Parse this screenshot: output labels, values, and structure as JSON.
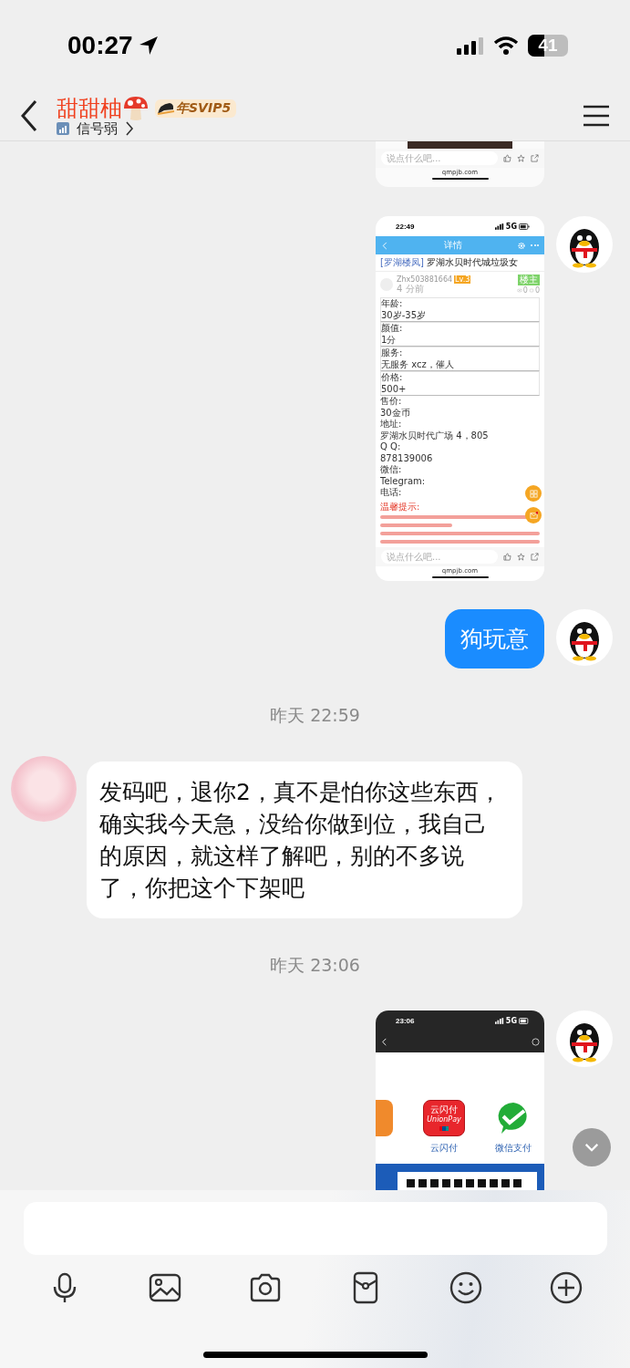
{
  "status_bar": {
    "time": "00:27",
    "battery": "41"
  },
  "header": {
    "name": "甜甜柚",
    "badge": "年SVIP5",
    "subtitle": "信号弱"
  },
  "messages": [
    {
      "kind": "image",
      "outgoing": true,
      "show_avatar": false,
      "screen": {
        "kind": "post_footer",
        "comment_placeholder": "说点什么吧...",
        "domain": "qmpjb.com"
      }
    },
    {
      "kind": "image",
      "outgoing": true,
      "show_avatar": true,
      "screen": {
        "kind": "post_detail",
        "time": "22:49",
        "network": "5G",
        "header_title": "详情",
        "tag": "[罗湖楼凤]",
        "title": "罗湖水贝时代城垃圾女",
        "user": "Zhx503881664",
        "level": "Lv.3",
        "posted": "4 分前",
        "role": "楼主",
        "views": "0",
        "comments": "0",
        "fields": [
          {
            "label": "年龄:",
            "value": "30岁-35岁",
            "boxed": true
          },
          {
            "label": "颜值:",
            "value": "1分",
            "boxed": true
          },
          {
            "label": "服务:",
            "value": "无服务 xcz，催人",
            "boxed": true
          },
          {
            "label": "价格:",
            "value": "500+",
            "boxed": true
          },
          {
            "label": "售价:",
            "value": "30金币",
            "boxed": false
          },
          {
            "label": "地址:",
            "value": "罗湖水贝时代广场 4，805",
            "boxed": false
          },
          {
            "label": "Q Q:",
            "value": "878139006",
            "boxed": false
          },
          {
            "label": "微信:",
            "boxed": false
          },
          {
            "label": "Telegram:",
            "boxed": false
          },
          {
            "label": "电话:",
            "boxed": false
          }
        ],
        "notice": "温馨提示:",
        "comment_placeholder": "说点什么吧...",
        "domain": "qmpjb.com"
      }
    },
    {
      "kind": "text",
      "outgoing": true,
      "text": "狗玩意"
    },
    {
      "kind": "time",
      "text": "昨天 22:59"
    },
    {
      "kind": "text",
      "outgoing": false,
      "text": "发码吧，退你2，真不是怕你这些东西，确实我今天急，没给你做到位，我自己的原因，就这样了解吧，别的不多说了，你把这个下架吧"
    },
    {
      "kind": "time",
      "text": "昨天 23:06"
    },
    {
      "kind": "image",
      "outgoing": true,
      "show_avatar": true,
      "screen": {
        "kind": "payment",
        "time": "23:06",
        "network": "5G",
        "apps": [
          {
            "kind": "orange"
          },
          {
            "kind": "unionpay",
            "label": "云闪付",
            "icon_text": "云闪付",
            "icon_sub": "UnionPay"
          },
          {
            "kind": "wechat",
            "label": "微信支付"
          }
        ]
      }
    }
  ]
}
